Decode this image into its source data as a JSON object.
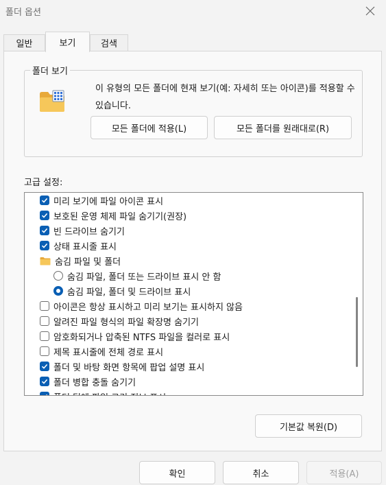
{
  "window": {
    "title": "폴더 옵션"
  },
  "tabs": [
    {
      "label": "일반"
    },
    {
      "label": "보기"
    },
    {
      "label": "검색"
    }
  ],
  "active_tab": "보기",
  "folder_view": {
    "group_label": "폴더 보기",
    "description": "이 유형의 모든 폴더에 현재 보기(예: 자세히 또는 아이콘)를 적용할 수 있습니다.",
    "apply_button": "모든 폴더에 적용(L)",
    "reset_button": "모든 폴더를 원래대로(R)"
  },
  "advanced": {
    "label": "고급 설정:",
    "items": [
      {
        "type": "checkbox",
        "checked": true,
        "label": "미리 보기에 파일 아이콘 표시"
      },
      {
        "type": "checkbox",
        "checked": true,
        "label": "보호된 운영 체제 파일 숨기기(권장)"
      },
      {
        "type": "checkbox",
        "checked": true,
        "label": "빈 드라이브 숨기기"
      },
      {
        "type": "checkbox",
        "checked": true,
        "label": "상태 표시줄 표시"
      },
      {
        "type": "folder",
        "label": "숨김 파일 및 폴더"
      },
      {
        "type": "radio",
        "checked": false,
        "label": "숨김 파일, 폴더 또는 드라이브 표시 안 함"
      },
      {
        "type": "radio",
        "checked": true,
        "label": "숨김 파일, 폴더 및 드라이브 표시"
      },
      {
        "type": "checkbox",
        "checked": false,
        "label": "아이콘은 항상 표시하고 미리 보기는 표시하지 않음"
      },
      {
        "type": "checkbox",
        "checked": false,
        "label": "알려진 파일 형식의 파일 확장명 숨기기"
      },
      {
        "type": "checkbox",
        "checked": false,
        "label": "암호화되거나 압축된 NTFS 파일을 컬러로 표시"
      },
      {
        "type": "checkbox",
        "checked": false,
        "label": "제목 표시줄에 전체 경로 표시"
      },
      {
        "type": "checkbox",
        "checked": true,
        "label": "폴더 및 바탕 화면 항목에 팝업 설명 표시"
      },
      {
        "type": "checkbox",
        "checked": true,
        "label": "폴더 병합 충돌 숨기기"
      },
      {
        "type": "checkbox",
        "checked": true,
        "label": "폴더 팁에 파일 크기 정보 표시"
      }
    ],
    "restore_button": "기본값 복원(D)"
  },
  "footer": {
    "ok": "확인",
    "cancel": "취소",
    "apply": "적용(A)"
  },
  "colors": {
    "accent": "#0a5fb4",
    "disabled_text": "#a0a0a0",
    "folder": "#f6c75a"
  }
}
